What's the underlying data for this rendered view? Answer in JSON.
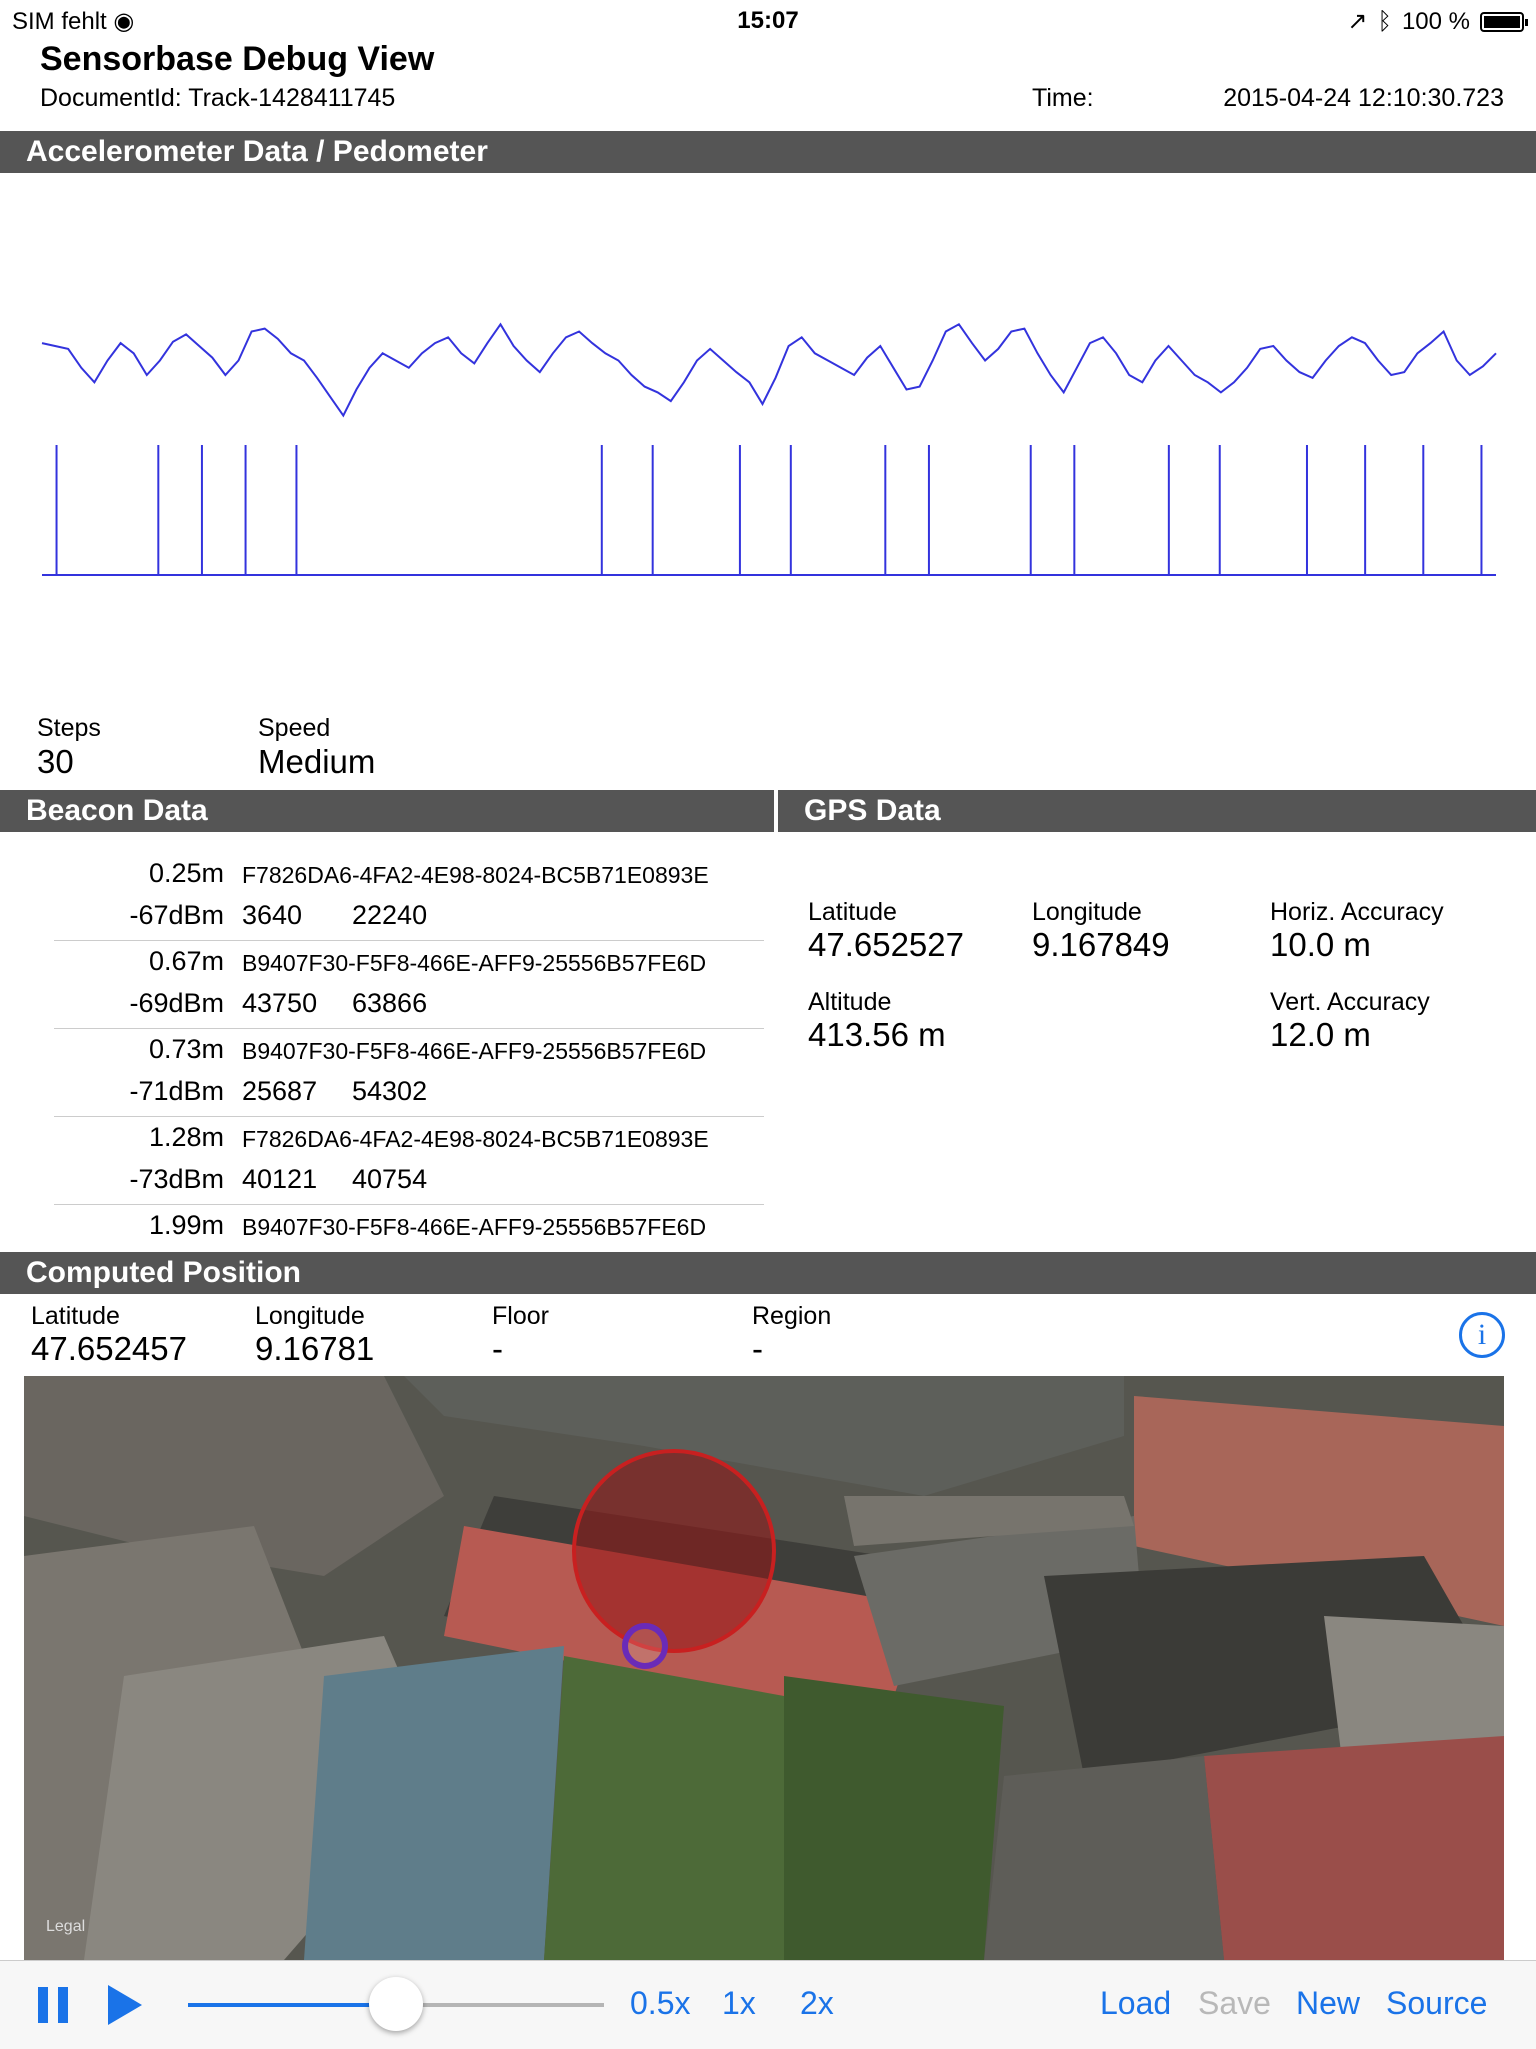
{
  "status_bar": {
    "carrier": "SIM fehlt",
    "time": "15:07",
    "battery": "100 %"
  },
  "header": {
    "title": "Sensorbase Debug View",
    "document_id_label": "DocumentId:",
    "document_id": "Track-1428411745",
    "time_label": "Time:",
    "time_value": "2015-04-24 12:10:30.723"
  },
  "accelerometer": {
    "section_title": "Accelerometer Data / Pedometer",
    "steps_label": "Steps",
    "steps_value": "30",
    "speed_label": "Speed",
    "speed_value": "Medium",
    "line_color": "#3333dd",
    "chart_data": {
      "type": "line",
      "series_signal": [
        0.62,
        0.6,
        0.58,
        0.45,
        0.35,
        0.5,
        0.62,
        0.55,
        0.4,
        0.5,
        0.63,
        0.68,
        0.6,
        0.52,
        0.4,
        0.5,
        0.7,
        0.72,
        0.65,
        0.55,
        0.5,
        0.38,
        0.25,
        0.12,
        0.3,
        0.45,
        0.55,
        0.5,
        0.45,
        0.55,
        0.62,
        0.66,
        0.55,
        0.48,
        0.62,
        0.75,
        0.6,
        0.5,
        0.42,
        0.55,
        0.66,
        0.7,
        0.62,
        0.55,
        0.5,
        0.4,
        0.32,
        0.28,
        0.22,
        0.35,
        0.5,
        0.58,
        0.5,
        0.42,
        0.35,
        0.2,
        0.38,
        0.6,
        0.66,
        0.55,
        0.5,
        0.45,
        0.4,
        0.52,
        0.6,
        0.45,
        0.3,
        0.32,
        0.5,
        0.7,
        0.75,
        0.62,
        0.5,
        0.58,
        0.7,
        0.72,
        0.55,
        0.4,
        0.28,
        0.45,
        0.62,
        0.66,
        0.55,
        0.4,
        0.35,
        0.5,
        0.6,
        0.5,
        0.4,
        0.35,
        0.28,
        0.35,
        0.45,
        0.58,
        0.6,
        0.5,
        0.42,
        0.38,
        0.5,
        0.6,
        0.66,
        0.62,
        0.5,
        0.4,
        0.42,
        0.55,
        0.62,
        0.7,
        0.5,
        0.4,
        0.46,
        0.55
      ],
      "step_markers": [
        0.01,
        0.08,
        0.11,
        0.14,
        0.175,
        0.385,
        0.42,
        0.48,
        0.515,
        0.58,
        0.61,
        0.68,
        0.71,
        0.775,
        0.81,
        0.87,
        0.91,
        0.95,
        0.99
      ]
    }
  },
  "beacon": {
    "section_title": "Beacon Data",
    "rows": [
      {
        "distance": "0.25m",
        "uuid": "F7826DA6-4FA2-4E98-8024-BC5B71E0893E",
        "rssi": "-67dBm",
        "major": "3640",
        "minor": "22240"
      },
      {
        "distance": "0.67m",
        "uuid": "B9407F30-F5F8-466E-AFF9-25556B57FE6D",
        "rssi": "-69dBm",
        "major": "43750",
        "minor": "63866"
      },
      {
        "distance": "0.73m",
        "uuid": "B9407F30-F5F8-466E-AFF9-25556B57FE6D",
        "rssi": "-71dBm",
        "major": "25687",
        "minor": "54302"
      },
      {
        "distance": "1.28m",
        "uuid": "F7826DA6-4FA2-4E98-8024-BC5B71E0893E",
        "rssi": "-73dBm",
        "major": "40121",
        "minor": "40754"
      },
      {
        "distance": "1.99m",
        "uuid": "B9407F30-F5F8-466E-AFF9-25556B57FE6D",
        "rssi": "",
        "major": "",
        "minor": ""
      }
    ]
  },
  "gps": {
    "section_title": "GPS Data",
    "latitude_label": "Latitude",
    "latitude": "47.652527",
    "longitude_label": "Longitude",
    "longitude": "9.167849",
    "horiz_label": "Horiz. Accuracy",
    "horiz": "10.0 m",
    "altitude_label": "Altitude",
    "altitude": "413.56 m",
    "vert_label": "Vert. Accuracy",
    "vert": "12.0 m"
  },
  "computed": {
    "section_title": "Computed Position",
    "latitude_label": "Latitude",
    "latitude": "47.652457",
    "longitude_label": "Longitude",
    "longitude": "9.16781",
    "floor_label": "Floor",
    "floor": "-",
    "region_label": "Region",
    "region": "-",
    "map_legal": "Legal",
    "info_icon": "i"
  },
  "toolbar": {
    "speed_half": "0.5x",
    "speed_1": "1x",
    "speed_2": "2x",
    "load": "Load",
    "save": "Save",
    "new": "New",
    "source": "Source",
    "slider_value": 0.5,
    "accent": "#1a73e8"
  }
}
